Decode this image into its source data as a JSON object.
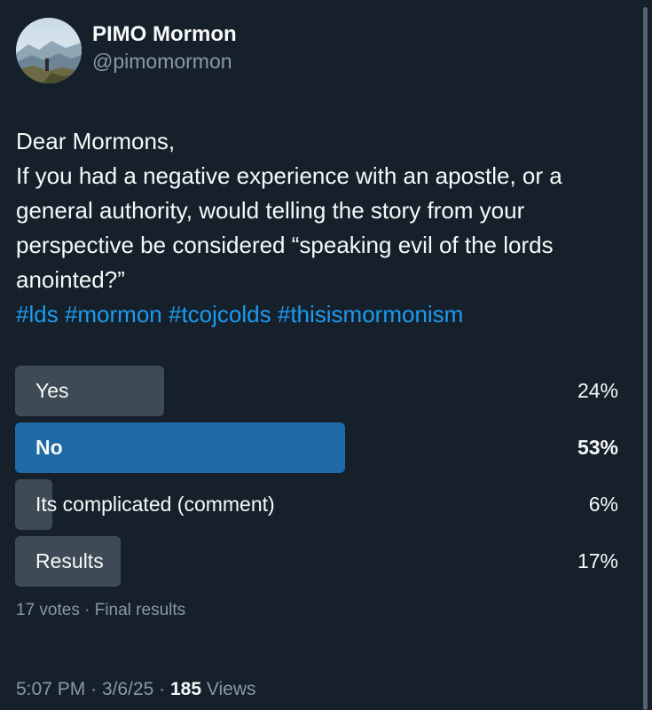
{
  "author": {
    "display_name": "PIMO Mormon",
    "handle": "@pimomormon"
  },
  "tweet": {
    "lines": [
      "Dear Mormons,",
      "If you had a negative experience with an apostle, or a",
      "general authority, would telling the story from your",
      "perspective be considered “speaking evil of the lords",
      "anointed?”"
    ],
    "hashtags": [
      "#lds",
      "#mormon",
      "#tcojcolds",
      "#thisismormonism"
    ]
  },
  "poll": {
    "options": [
      {
        "label": "Yes",
        "percent": "24%",
        "value": 24,
        "winner": false
      },
      {
        "label": "No",
        "percent": "53%",
        "value": 53,
        "winner": true
      },
      {
        "label": "Its complicated (comment)",
        "percent": "6%",
        "value": 6,
        "winner": false
      },
      {
        "label": "Results",
        "percent": "17%",
        "value": 17,
        "winner": false
      }
    ],
    "votes_text": "17 votes · Final results"
  },
  "meta": {
    "time": "5:07 PM",
    "separator": "·",
    "date": "3/6/25",
    "views_count": "185",
    "views_label": "Views"
  },
  "colors": {
    "background": "#15202b",
    "hashtag": "#1d9bf0",
    "winner_bar": "#1d6aa6",
    "bar": "#3e4a55",
    "secondary_text": "#8b98a5"
  }
}
